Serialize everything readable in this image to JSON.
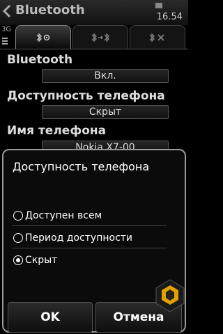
{
  "header": {
    "title": "Bluetooth",
    "time": "16.54",
    "network": "3G"
  },
  "settings": [
    {
      "label": "Bluetooth",
      "value": "Вкл."
    },
    {
      "label": "Доступность телефона",
      "value": "Скрыт"
    },
    {
      "label": "Имя телефона",
      "value": "Nokia X7-00"
    }
  ],
  "dialog": {
    "title": "Доступность телефона",
    "options": [
      {
        "label": "Доступен всем",
        "selected": false
      },
      {
        "label": "Период доступности",
        "selected": false
      },
      {
        "label": "Скрыт",
        "selected": true
      }
    ],
    "ok_label": "OK",
    "cancel_label": "Отмена"
  },
  "colors": {
    "background": "#000000",
    "text": "#ffffff",
    "border": "#9a9a9a",
    "accent": "#e0a000"
  }
}
